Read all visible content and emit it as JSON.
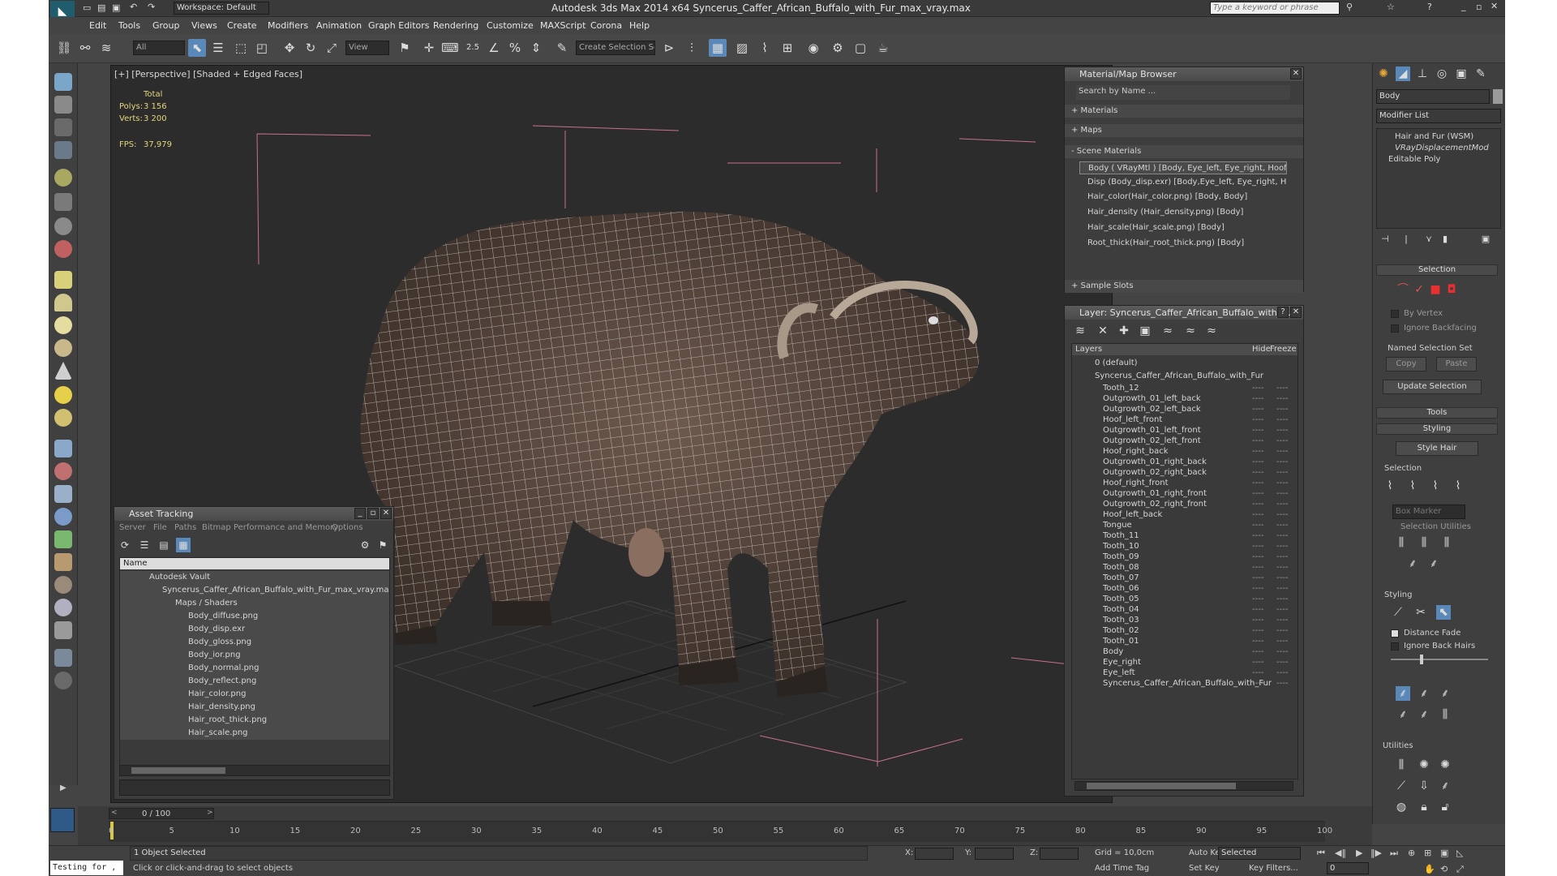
{
  "window": {
    "title": "Autodesk 3ds Max  2014 x64     Syncerus_Caffer_African_Buffalo_with_Fur_max_vray.max",
    "workspace": "Workspace: Default",
    "search_placeholder": "Type a keyword or phrase"
  },
  "menu": [
    "Edit",
    "Tools",
    "Group",
    "Views",
    "Create",
    "Modifiers",
    "Animation",
    "Graph Editors",
    "Rendering",
    "Customize",
    "MAXScript",
    "Corona",
    "Help"
  ],
  "toolbar": {
    "filter": "All",
    "ref_coord": "View",
    "spinner": "2.5",
    "selection_set": "Create Selection Se"
  },
  "viewport": {
    "label": "[+] [Perspective] [Shaded + Edged Faces]",
    "stats_header": "Total",
    "polys_label": "Polys:",
    "polys": "3 156",
    "verts_label": "Verts:",
    "verts": "3 200",
    "fps_label": "FPS:",
    "fps": "37,979"
  },
  "material_browser": {
    "title": "Material/Map Browser",
    "search": "Search by Name ...",
    "sections": {
      "materials": "+ Materials",
      "maps": "+ Maps",
      "scene": "- Scene Materials",
      "sample": "+ Sample Slots"
    },
    "items": [
      "Body  ( VRayMtl ) [Body, Eye_left, Eye_right, Hoof_left_back,",
      "Disp (Body_disp.exr) [Body,Eye_left, Eye_right, Hoof_left_bac..",
      "Hair_color(Hair_color.png) [Body, Body]",
      "Hair_density (Hair_density.png) [Body]",
      "Hair_scale(Hair_scale.png) [Body]",
      "Root_thick(Hair_root_thick.png) [Body]"
    ]
  },
  "layer_panel": {
    "title": "Layer: Syncerus_Caffer_African_Buffalo_with_Fur",
    "col_layers": "Layers",
    "col_hide": "Hide",
    "col_freeze": "Freeze",
    "default_layer": "0 (default)",
    "main_layer": "Syncerus_Caffer_African_Buffalo_with_Fur",
    "objects": [
      "Tooth_12",
      "Outgrowth_01_left_back",
      "Outgrowth_02_left_back",
      "Hoof_left_front",
      "Outgrowth_01_left_front",
      "Outgrowth_02_left_front",
      "Hoof_right_back",
      "Outgrowth_01_right_back",
      "Outgrowth_02_right_back",
      "Hoof_right_front",
      "Outgrowth_01_right_front",
      "Outgrowth_02_right_front",
      "Hoof_left_back",
      "Tongue",
      "Tooth_11",
      "Tooth_10",
      "Tooth_09",
      "Tooth_08",
      "Tooth_07",
      "Tooth_06",
      "Tooth_05",
      "Tooth_04",
      "Tooth_03",
      "Tooth_02",
      "Tooth_01",
      "Body",
      "Eye_right",
      "Eye_left",
      "Syncerus_Caffer_African_Buffalo_with_Fur"
    ],
    "dash": "----"
  },
  "asset_tracking": {
    "title": "Asset Tracking",
    "menu": [
      "Server",
      "File",
      "Paths",
      "Bitmap Performance and Memory",
      "Options"
    ],
    "col_name": "Name",
    "vault": "Autodesk Vault",
    "file": "Syncerus_Caffer_African_Buffalo_with_Fur_max_vray.max",
    "folder": "Maps / Shaders",
    "maps": [
      "Body_diffuse.png",
      "Body_disp.exr",
      "Body_gloss.png",
      "Body_ior.png",
      "Body_normal.png",
      "Body_reflect.png",
      "Hair_color.png",
      "Hair_density.png",
      "Hair_root_thick.png",
      "Hair_scale.png"
    ]
  },
  "command_panel": {
    "object_name": "Body",
    "modifier_list": "Modifier List",
    "stack": [
      "Hair and Fur (WSM)",
      "VRayDisplacementMod",
      "Editable Poly"
    ],
    "selection_title": "Selection",
    "by_vertex": "By Vertex",
    "ignore_backfacing": "Ignore Backfacing",
    "named_sel": "Named Selection Set",
    "copy": "Copy",
    "paste": "Paste",
    "update_selection": "Update Selection",
    "tools": "Tools",
    "styling": "Styling",
    "style_hair": "Style Hair",
    "sub_selection": "Selection",
    "box_marker": "Box Marker",
    "sel_utilities": "Selection Utilities",
    "sub_styling": "Styling",
    "distance_fade": "Distance Fade",
    "ignore_back_hairs": "Ignore Back Hairs",
    "utilities": "Utilities"
  },
  "timeline": {
    "frame": "0 / 100",
    "ticks": [
      "0",
      "5",
      "10",
      "15",
      "20",
      "25",
      "30",
      "35",
      "40",
      "45",
      "50",
      "55",
      "60",
      "65",
      "70",
      "75",
      "80",
      "85",
      "90",
      "95",
      "100"
    ]
  },
  "status": {
    "script_box": "Testing for ,",
    "selected": "1 Object Selected",
    "prompt": "Click or click-and-drag to select objects",
    "x_label": "X:",
    "y_label": "Y:",
    "z_label": "Z:",
    "grid": "Grid = 10,0cm",
    "auto_key": "Auto Key",
    "set_key": "Set Key",
    "selected_combo": "Selected",
    "key_filters": "Key Filters...",
    "add_time_tag": "Add Time Tag",
    "frame_value": "0"
  }
}
